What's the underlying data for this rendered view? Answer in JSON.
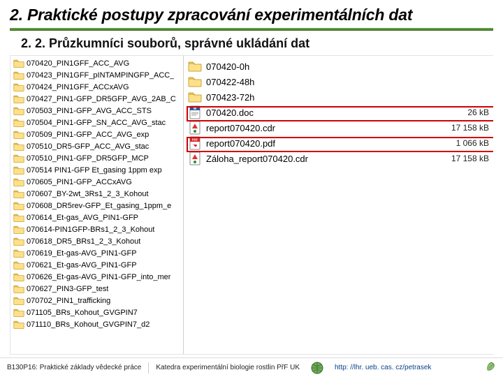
{
  "title": "2. Praktické postupy zpracování experimentálních dat",
  "subtitle": "2. 2. Průzkumníci souborů, správné ukládání dat",
  "left_pane": {
    "items": [
      "070420_PIN1GFF_ACC_AVG",
      "070423_PIN1GFF_pINTAMPINGFP_ACC_",
      "070424_PIN1GFF_ACCxAVG",
      "070427_PIN1-GFP_DR5GFP_AVG_2AB_C",
      "070503_PIN1-GFP_AVG_ACC_STS",
      "070504_PIN1-GFP_SN_ACC_AVG_stac",
      "070509_PIN1-GFP_ACC_AVG_exp",
      "070510_DR5-GFP_ACC_AVG_stac",
      "070510_PIN1-GFP_DR5GFP_MCP",
      "070514 PIN1-GFP Et_gasing 1ppm exp",
      "070605_PIN1-GFP_ACCxAVG",
      "070607_BY-2wt_3Rs1_2_3_Kohout",
      "070608_DR5rev-GFP_Et_gasing_1ppm_e",
      "070614_Et-gas_AVG_PIN1-GFP",
      "070614-PIN1GFP-BRs1_2_3_Kohout",
      "070618_DR5_BRs1_2_3_Kohout",
      "070619_Et-gas-AVG_PIN1-GFP",
      "070621_Et-gas-AVG_PIN1-GFP",
      "070626_Et-gas-AVG_PIN1-GFP_into_mer",
      "070627_PIN3-GFP_test",
      "070702_PIN1_trafficking",
      "071105_BRs_Kohout_GVGPIN7",
      "071110_BRs_Kohout_GVGPIN7_d2"
    ]
  },
  "right_pane": {
    "items": [
      {
        "type": "folder",
        "name": "070420-0h",
        "size": ""
      },
      {
        "type": "folder",
        "name": "070422-48h",
        "size": ""
      },
      {
        "type": "folder",
        "name": "070423-72h",
        "size": ""
      },
      {
        "type": "doc",
        "name": "070420.doc",
        "size": "26 kB"
      },
      {
        "type": "cdr",
        "name": "report070420.cdr",
        "size": "17 158 kB"
      },
      {
        "type": "pdf",
        "name": "report070420.pdf",
        "size": "1 066 kB"
      },
      {
        "type": "cdr",
        "name": "Záloha_report070420.cdr",
        "size": "17 158 kB"
      }
    ]
  },
  "footer": {
    "left": "B130P16: Praktické základy vědecké práce",
    "mid": "Katedra experimentální biologie rostlin PřF UK",
    "link": "http: //lhr. ueb. cas. cz/petrasek"
  },
  "icons": {
    "folder": "folder-icon",
    "doc": "word-doc-icon",
    "cdr": "corel-cdr-icon",
    "pdf": "pdf-icon"
  }
}
